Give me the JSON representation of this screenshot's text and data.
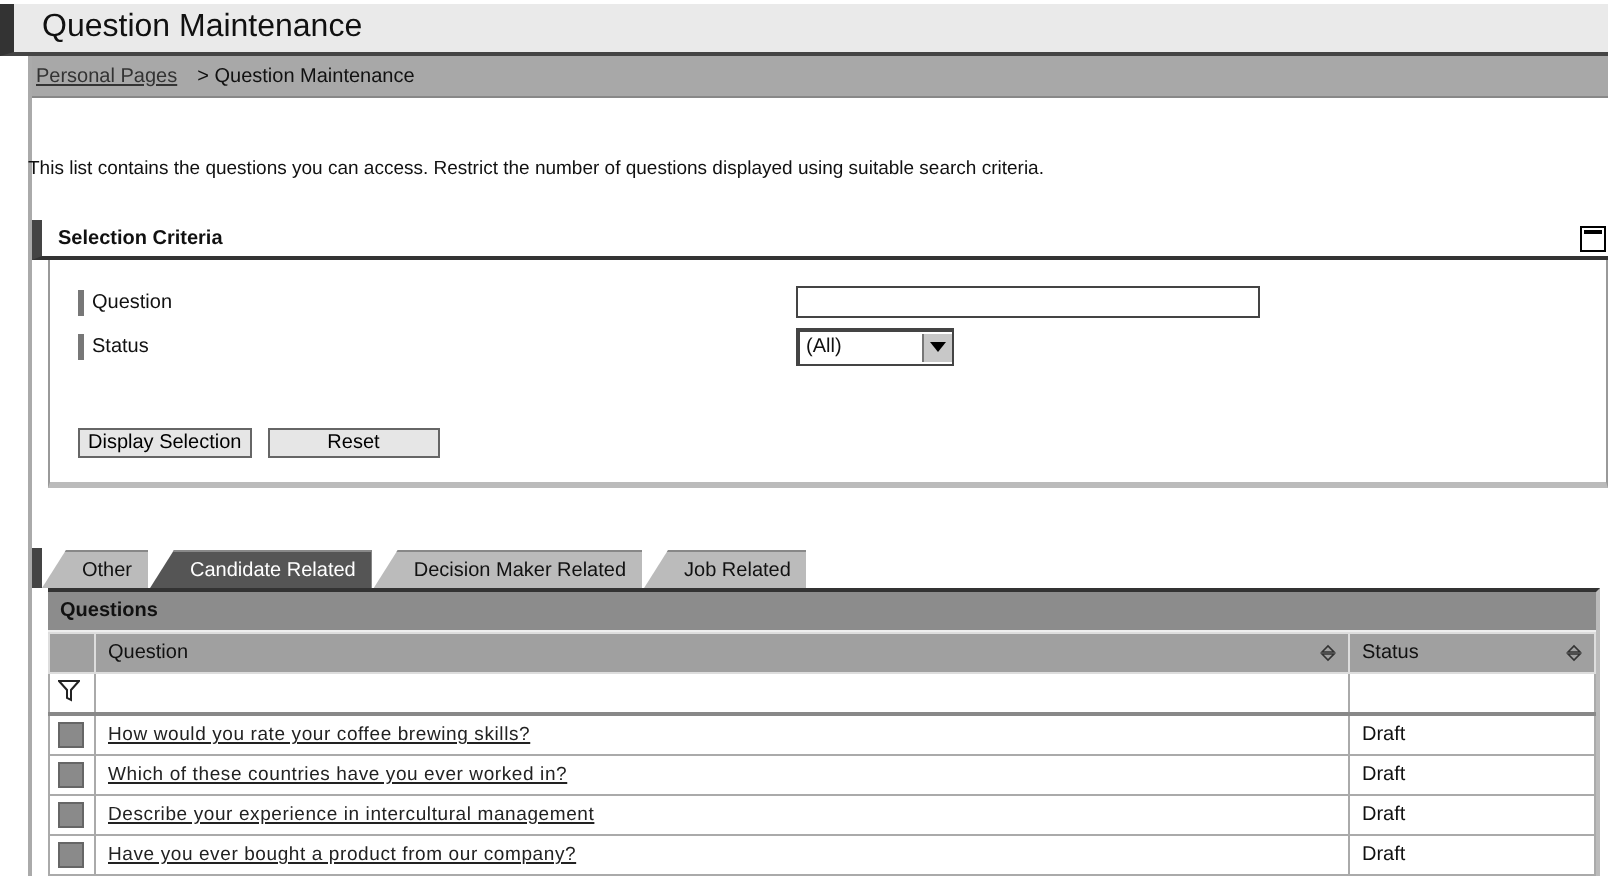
{
  "page_title": "Question Maintenance",
  "breadcrumb": {
    "link": "Personal Pages",
    "current": "> Question Maintenance"
  },
  "description": "This list contains the questions you can access. Restrict the number of questions displayed using suitable search criteria.",
  "selection_criteria": {
    "title": "Selection Criteria",
    "expanded": true,
    "fields": [
      {
        "kind": "text",
        "label": "Question"
      },
      {
        "kind": "select",
        "label": "Status",
        "value": "(All)"
      }
    ],
    "buttons": [
      "Display Selection",
      "Reset"
    ]
  },
  "tabs": [
    {
      "label": "Other",
      "selected": false
    },
    {
      "label": "Candidate Related",
      "selected": true
    },
    {
      "label": "Decision Maker Related",
      "selected": false
    },
    {
      "label": "Job Related",
      "selected": false
    }
  ],
  "table": {
    "title": "Questions",
    "columns": [
      "Question",
      "Status"
    ],
    "rows": [
      {
        "question": "How would you rate your coffee brewing skills?",
        "status": "Draft"
      },
      {
        "question": "Which of these countries have you ever worked in?",
        "status": "Draft"
      },
      {
        "question": "Describe your experience in intercultural management",
        "status": "Draft"
      },
      {
        "question": "Have you ever bought a product from our company?",
        "status": "Draft"
      }
    ]
  }
}
